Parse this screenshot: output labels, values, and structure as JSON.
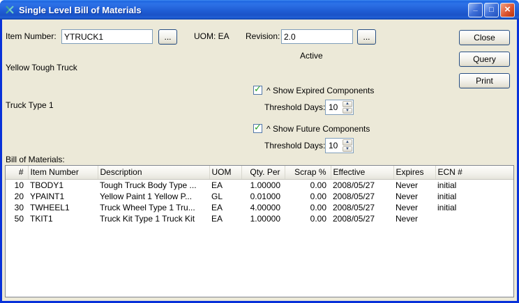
{
  "window": {
    "title": "Single Level Bill of Materials"
  },
  "icons": {
    "minimize": "_",
    "maximize": "□",
    "close": "×",
    "check": "✓",
    "spin_up": "▲",
    "spin_down": "▼"
  },
  "form": {
    "item_number_label": "Item Number:",
    "item_number_value": "YTRUCK1",
    "item_browse_label": "...",
    "uom_label": "UOM: EA",
    "revision_label": "Revision:",
    "revision_value": "2.0",
    "revision_browse_label": "...",
    "revision_status": "Active",
    "item_description": "Yellow Tough Truck",
    "item_type": "Truck Type 1",
    "show_expired_label": "^ Show Expired Components",
    "expired_threshold_label": "Threshold Days:",
    "expired_threshold_value": "10",
    "show_future_label": "^ Show Future Components",
    "future_threshold_label": "Threshold Days:",
    "future_threshold_value": "10"
  },
  "buttons": {
    "close": "Close",
    "query": "Query",
    "print": "Print"
  },
  "bom": {
    "label": "Bill of Materials:",
    "columns": [
      "#",
      "Item Number",
      "Description",
      "UOM",
      "Qty. Per",
      "Scrap %",
      "Effective",
      "Expires",
      "ECN #"
    ],
    "rows": [
      [
        "10",
        "TBODY1",
        "Tough Truck Body Type ...",
        "EA",
        "1.00000",
        "0.00",
        "2008/05/27",
        "Never",
        "initial"
      ],
      [
        "20",
        "YPAINT1",
        "Yellow Paint 1  Yellow P...",
        "GL",
        "0.01000",
        "0.00",
        "2008/05/27",
        "Never",
        "initial"
      ],
      [
        "30",
        "TWHEEL1",
        "Truck Wheel Type 1 Tru...",
        "EA",
        "4.00000",
        "0.00",
        "2008/05/27",
        "Never",
        "initial"
      ],
      [
        "50",
        "TKIT1",
        "Truck Kit Type 1 Truck Kit",
        "EA",
        "1.00000",
        "0.00",
        "2008/05/27",
        "Never",
        ""
      ]
    ]
  },
  "colors": {
    "titlebar_blue": "#1F5DD4",
    "window_border": "#0831D9",
    "content_bg": "#ECE9D8",
    "field_border": "#7F9DB9",
    "check_green": "#21A121"
  }
}
